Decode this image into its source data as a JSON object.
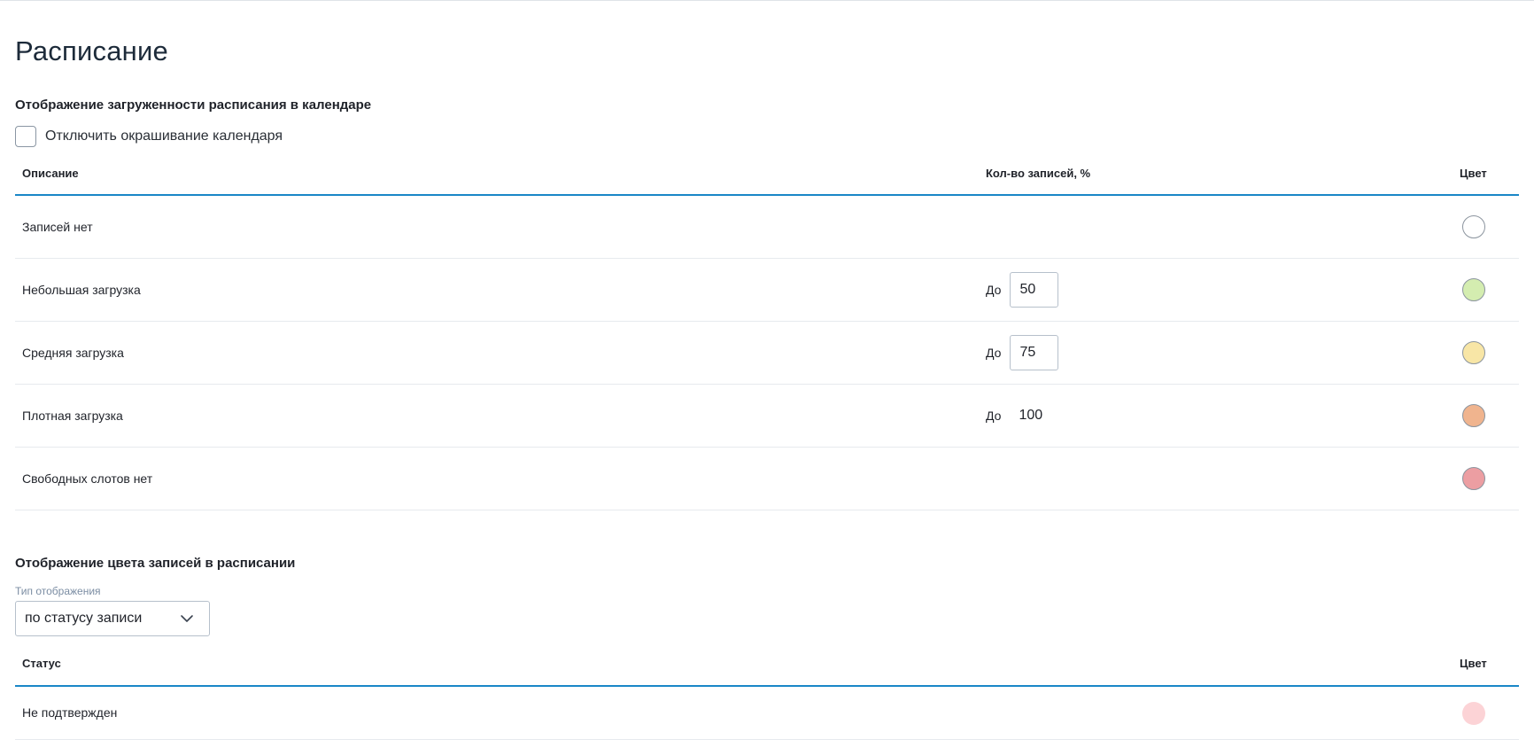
{
  "page_title": "Расписание",
  "calendar_load": {
    "section_title": "Отображение загруженности расписания в календаре",
    "disable_coloring_label": "Отключить окрашивание календаря",
    "disable_coloring_checked": false,
    "headers": {
      "description": "Описание",
      "count": "Кол-во записей, %",
      "color": "Цвет"
    },
    "rows": [
      {
        "description": "Записей нет",
        "prefix": "",
        "value": "",
        "color": "#ffffff"
      },
      {
        "description": "Небольшая загрузка",
        "prefix": "До",
        "value": "50",
        "color": "#d4edb0"
      },
      {
        "description": "Средняя загрузка",
        "prefix": "До",
        "value": "75",
        "color": "#f8e6a6"
      },
      {
        "description": "Плотная загрузка",
        "prefix": "До",
        "value": "100",
        "color": "#f0b48e"
      },
      {
        "description": "Свободных слотов нет",
        "prefix": "",
        "value": "",
        "color": "#ec9ea2"
      }
    ]
  },
  "record_colors": {
    "section_title": "Отображение цвета записей в расписании",
    "display_type_label": "Тип отображения",
    "display_type_value": "по статусу записи",
    "headers": {
      "status": "Статус",
      "color": "Цвет"
    },
    "rows": [
      {
        "status": "Не подтвержден",
        "color": "#fcd3d6"
      }
    ]
  }
}
